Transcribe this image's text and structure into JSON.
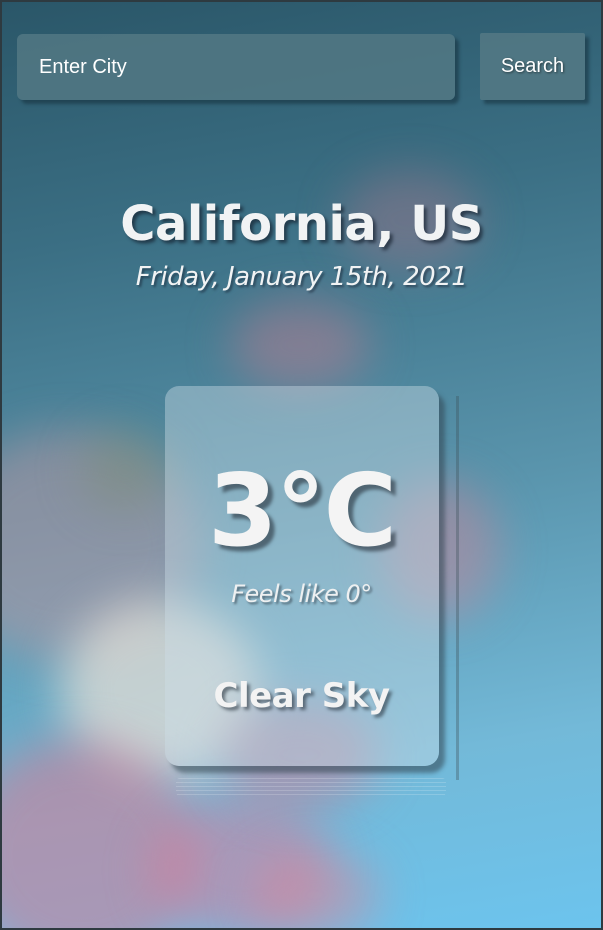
{
  "search": {
    "placeholder": "Enter City",
    "button_label": "Search"
  },
  "header": {
    "location": "California, US",
    "date": "Friday, January 15th, 2021"
  },
  "weather": {
    "temperature": "3°C",
    "feels_like": "Feels like 0°",
    "condition": "Clear Sky"
  },
  "colors": {
    "background_top": "#2a5668",
    "background_bottom": "#6cc4ee",
    "control_bg": "#527884",
    "text": "#f1f3f4"
  }
}
